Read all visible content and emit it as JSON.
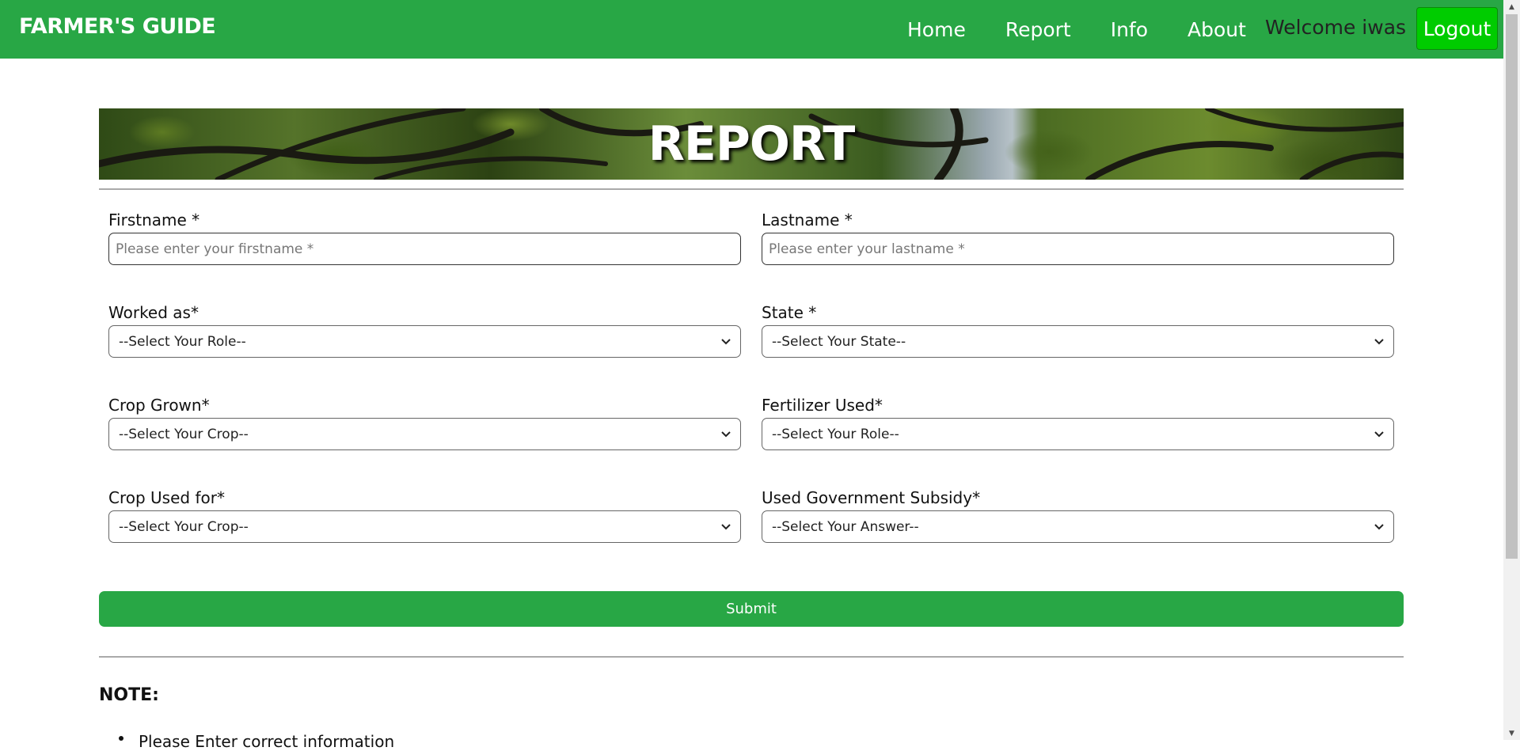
{
  "nav": {
    "brand": "FARMER'S GUIDE",
    "links": [
      "Home",
      "Report",
      "Info",
      "About"
    ],
    "welcome": "Welcome iwas",
    "logout": "Logout"
  },
  "banner": {
    "title": "REPORT"
  },
  "form": {
    "firstname": {
      "label": "Firstname *",
      "placeholder": "Please enter your firstname *"
    },
    "lastname": {
      "label": "Lastname *",
      "placeholder": "Please enter your lastname *"
    },
    "worked_as": {
      "label": "Worked as*",
      "value": "--Select Your Role--"
    },
    "state": {
      "label": "State *",
      "value": "--Select Your State--"
    },
    "crop_grown": {
      "label": "Crop Grown*",
      "value": "--Select Your Crop--"
    },
    "fertilizer": {
      "label": "Fertilizer Used*",
      "value": "--Select Your Role--"
    },
    "crop_used_for": {
      "label": "Crop Used for*",
      "value": "--Select Your Crop--"
    },
    "subsidy": {
      "label": "Used Government Subsidy*",
      "value": "--Select Your Answer--"
    },
    "submit": "Submit"
  },
  "note": {
    "title": "NOTE:",
    "items": [
      "Please Enter correct information"
    ]
  },
  "colors": {
    "brand_green": "#28a745",
    "logout_green": "#00cc00"
  }
}
